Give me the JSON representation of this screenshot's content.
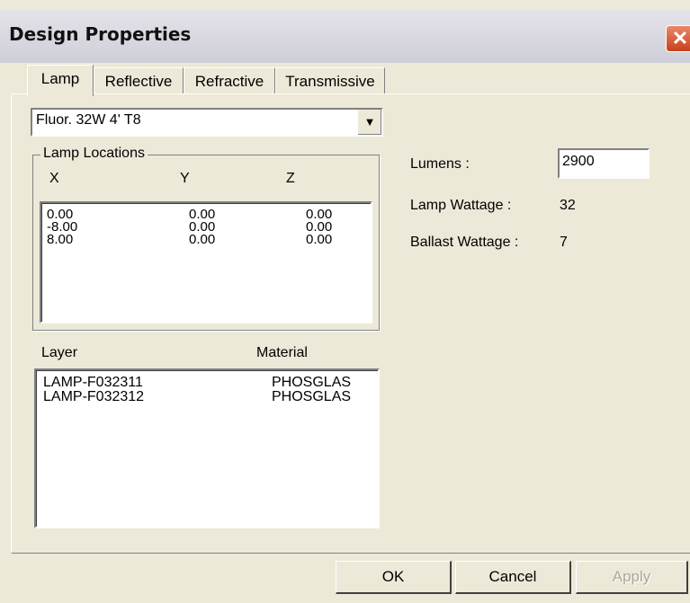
{
  "window": {
    "title": "Design Properties",
    "close_glyph": "✕"
  },
  "tabs": [
    {
      "label": "Lamp"
    },
    {
      "label": "Reflective"
    },
    {
      "label": "Refractive"
    },
    {
      "label": "Transmissive"
    }
  ],
  "lamp_type": {
    "selected": "Fluor. 32W 4' T8",
    "dropdown_icon": "chevron-down-icon"
  },
  "lamp_locations": {
    "legend": "Lamp Locations",
    "headers": [
      "X",
      "Y",
      "Z"
    ],
    "rows": [
      [
        "0.00",
        "0.00",
        "0.00"
      ],
      [
        "-8.00",
        "0.00",
        "0.00"
      ],
      [
        "8.00",
        "0.00",
        "0.00"
      ]
    ]
  },
  "layers": {
    "headers": [
      "Layer",
      "Material"
    ],
    "rows": [
      [
        "LAMP-F032311",
        "PHOSGLAS"
      ],
      [
        "LAMP-F032312",
        "PHOSGLAS"
      ]
    ]
  },
  "properties": {
    "lumens_label": "Lumens :",
    "lumens_value": "2900",
    "lamp_wattage_label": "Lamp Wattage :",
    "lamp_wattage_value": "32",
    "ballast_wattage_label": "Ballast Wattage :",
    "ballast_wattage_value": "7"
  },
  "buttons": {
    "ok": "OK",
    "cancel": "Cancel",
    "apply": "Apply"
  },
  "colors": {
    "window_bg": "#ece9d8",
    "close_red": "#c8401c"
  }
}
